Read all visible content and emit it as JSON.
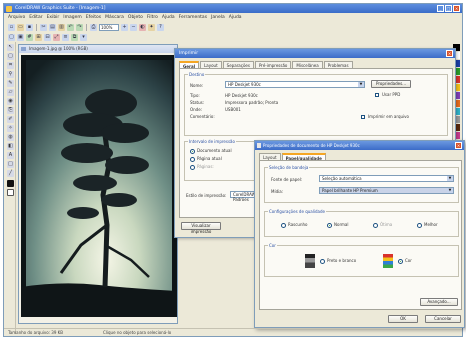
{
  "window": {
    "title": "CorelDRAW Graphics Suite - [Imagem-1]",
    "controls": {
      "minimize": "_",
      "maximize": "□",
      "close": "×"
    }
  },
  "menu": [
    "Arquivo",
    "Editar",
    "Exibir",
    "Imagem",
    "Efeitos",
    "Máscara",
    "Objeto",
    "Filtro",
    "Ajuda",
    "Ferramentas",
    "Janela",
    "Ajuda"
  ],
  "toolbar": {
    "zoom": "100%"
  },
  "document": {
    "title": "Imagem-1.jpg @ 100% (RGB)"
  },
  "status": {
    "size": "Tamanho do arquivo: 39 KB",
    "hint": "Clique no objeto para selecioná-lo"
  },
  "print_dialog": {
    "title": "Imprimir",
    "tabs": [
      "Geral",
      "Layout",
      "Separações",
      "Pré-impressão",
      "Miscelânea",
      "Problemas"
    ],
    "printer_group": "Destino",
    "name_label": "Nome:",
    "name_value": "HP Deskjet 930c",
    "props_button": "Propriedades...",
    "fields": [
      {
        "label": "Tipo:",
        "value": "HP Deskjet 930c"
      },
      {
        "label": "Status:",
        "value": "Impressora padrão; Pronta"
      },
      {
        "label": "Onde:",
        "value": "USB001"
      },
      {
        "label": "Comentário:",
        "value": ""
      }
    ],
    "print_to_file": "Imprimir em arquivo",
    "use_ppd": "Usar PPD",
    "range_group": "Intervalo de impressão",
    "range_options": [
      "Documento atual",
      "Página atual",
      "Páginas:"
    ],
    "copies_label": "Cópias",
    "style_label": "Estilo de impressão:",
    "style_value": "CorelDRAW Padrões",
    "preview_button": "Visualizar impressão",
    "print_button": "Imprimir",
    "cancel_button": "Cancelar"
  },
  "properties_dialog": {
    "title": "Propriedades de documento de HP Deskjet 930c",
    "tabs": [
      "Layout",
      "Papel/qualidade"
    ],
    "tray_group": "Seleção de bandeja",
    "source_label": "Fonte de papel:",
    "source_value": "Seleção automática",
    "media_label": "Mídia:",
    "media_value": "Papel brilhante HP Premium",
    "quality_group": "Configurações de qualidade",
    "quality_options": [
      "Rascunho",
      "Normal",
      "Ótima",
      "Melhor"
    ],
    "color_group": "Cor",
    "color_options": [
      "Preto e branco",
      "Cor"
    ],
    "advanced_button": "Avançado...",
    "ok_button": "OK",
    "cancel_button": "Cancelar"
  }
}
